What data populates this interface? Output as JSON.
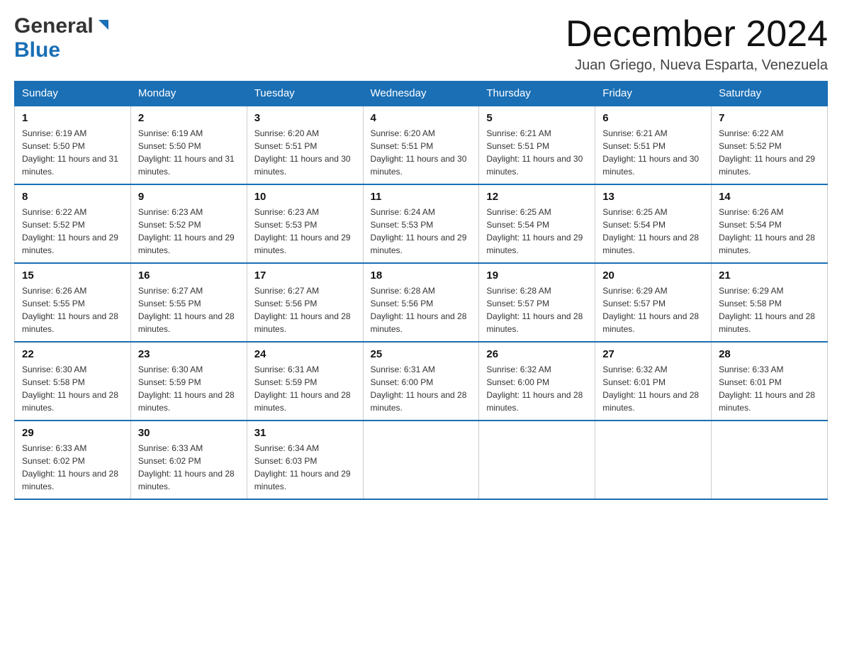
{
  "header": {
    "logo_general": "General",
    "logo_blue": "Blue",
    "month_title": "December 2024",
    "location": "Juan Griego, Nueva Esparta, Venezuela"
  },
  "days_of_week": [
    "Sunday",
    "Monday",
    "Tuesday",
    "Wednesday",
    "Thursday",
    "Friday",
    "Saturday"
  ],
  "weeks": [
    [
      {
        "day": "1",
        "sunrise": "6:19 AM",
        "sunset": "5:50 PM",
        "daylight": "11 hours and 31 minutes."
      },
      {
        "day": "2",
        "sunrise": "6:19 AM",
        "sunset": "5:50 PM",
        "daylight": "11 hours and 31 minutes."
      },
      {
        "day": "3",
        "sunrise": "6:20 AM",
        "sunset": "5:51 PM",
        "daylight": "11 hours and 30 minutes."
      },
      {
        "day": "4",
        "sunrise": "6:20 AM",
        "sunset": "5:51 PM",
        "daylight": "11 hours and 30 minutes."
      },
      {
        "day": "5",
        "sunrise": "6:21 AM",
        "sunset": "5:51 PM",
        "daylight": "11 hours and 30 minutes."
      },
      {
        "day": "6",
        "sunrise": "6:21 AM",
        "sunset": "5:51 PM",
        "daylight": "11 hours and 30 minutes."
      },
      {
        "day": "7",
        "sunrise": "6:22 AM",
        "sunset": "5:52 PM",
        "daylight": "11 hours and 29 minutes."
      }
    ],
    [
      {
        "day": "8",
        "sunrise": "6:22 AM",
        "sunset": "5:52 PM",
        "daylight": "11 hours and 29 minutes."
      },
      {
        "day": "9",
        "sunrise": "6:23 AM",
        "sunset": "5:52 PM",
        "daylight": "11 hours and 29 minutes."
      },
      {
        "day": "10",
        "sunrise": "6:23 AM",
        "sunset": "5:53 PM",
        "daylight": "11 hours and 29 minutes."
      },
      {
        "day": "11",
        "sunrise": "6:24 AM",
        "sunset": "5:53 PM",
        "daylight": "11 hours and 29 minutes."
      },
      {
        "day": "12",
        "sunrise": "6:25 AM",
        "sunset": "5:54 PM",
        "daylight": "11 hours and 29 minutes."
      },
      {
        "day": "13",
        "sunrise": "6:25 AM",
        "sunset": "5:54 PM",
        "daylight": "11 hours and 28 minutes."
      },
      {
        "day": "14",
        "sunrise": "6:26 AM",
        "sunset": "5:54 PM",
        "daylight": "11 hours and 28 minutes."
      }
    ],
    [
      {
        "day": "15",
        "sunrise": "6:26 AM",
        "sunset": "5:55 PM",
        "daylight": "11 hours and 28 minutes."
      },
      {
        "day": "16",
        "sunrise": "6:27 AM",
        "sunset": "5:55 PM",
        "daylight": "11 hours and 28 minutes."
      },
      {
        "day": "17",
        "sunrise": "6:27 AM",
        "sunset": "5:56 PM",
        "daylight": "11 hours and 28 minutes."
      },
      {
        "day": "18",
        "sunrise": "6:28 AM",
        "sunset": "5:56 PM",
        "daylight": "11 hours and 28 minutes."
      },
      {
        "day": "19",
        "sunrise": "6:28 AM",
        "sunset": "5:57 PM",
        "daylight": "11 hours and 28 minutes."
      },
      {
        "day": "20",
        "sunrise": "6:29 AM",
        "sunset": "5:57 PM",
        "daylight": "11 hours and 28 minutes."
      },
      {
        "day": "21",
        "sunrise": "6:29 AM",
        "sunset": "5:58 PM",
        "daylight": "11 hours and 28 minutes."
      }
    ],
    [
      {
        "day": "22",
        "sunrise": "6:30 AM",
        "sunset": "5:58 PM",
        "daylight": "11 hours and 28 minutes."
      },
      {
        "day": "23",
        "sunrise": "6:30 AM",
        "sunset": "5:59 PM",
        "daylight": "11 hours and 28 minutes."
      },
      {
        "day": "24",
        "sunrise": "6:31 AM",
        "sunset": "5:59 PM",
        "daylight": "11 hours and 28 minutes."
      },
      {
        "day": "25",
        "sunrise": "6:31 AM",
        "sunset": "6:00 PM",
        "daylight": "11 hours and 28 minutes."
      },
      {
        "day": "26",
        "sunrise": "6:32 AM",
        "sunset": "6:00 PM",
        "daylight": "11 hours and 28 minutes."
      },
      {
        "day": "27",
        "sunrise": "6:32 AM",
        "sunset": "6:01 PM",
        "daylight": "11 hours and 28 minutes."
      },
      {
        "day": "28",
        "sunrise": "6:33 AM",
        "sunset": "6:01 PM",
        "daylight": "11 hours and 28 minutes."
      }
    ],
    [
      {
        "day": "29",
        "sunrise": "6:33 AM",
        "sunset": "6:02 PM",
        "daylight": "11 hours and 28 minutes."
      },
      {
        "day": "30",
        "sunrise": "6:33 AM",
        "sunset": "6:02 PM",
        "daylight": "11 hours and 28 minutes."
      },
      {
        "day": "31",
        "sunrise": "6:34 AM",
        "sunset": "6:03 PM",
        "daylight": "11 hours and 29 minutes."
      },
      null,
      null,
      null,
      null
    ]
  ],
  "labels": {
    "sunrise_prefix": "Sunrise: ",
    "sunset_prefix": "Sunset: ",
    "daylight_prefix": "Daylight: "
  }
}
